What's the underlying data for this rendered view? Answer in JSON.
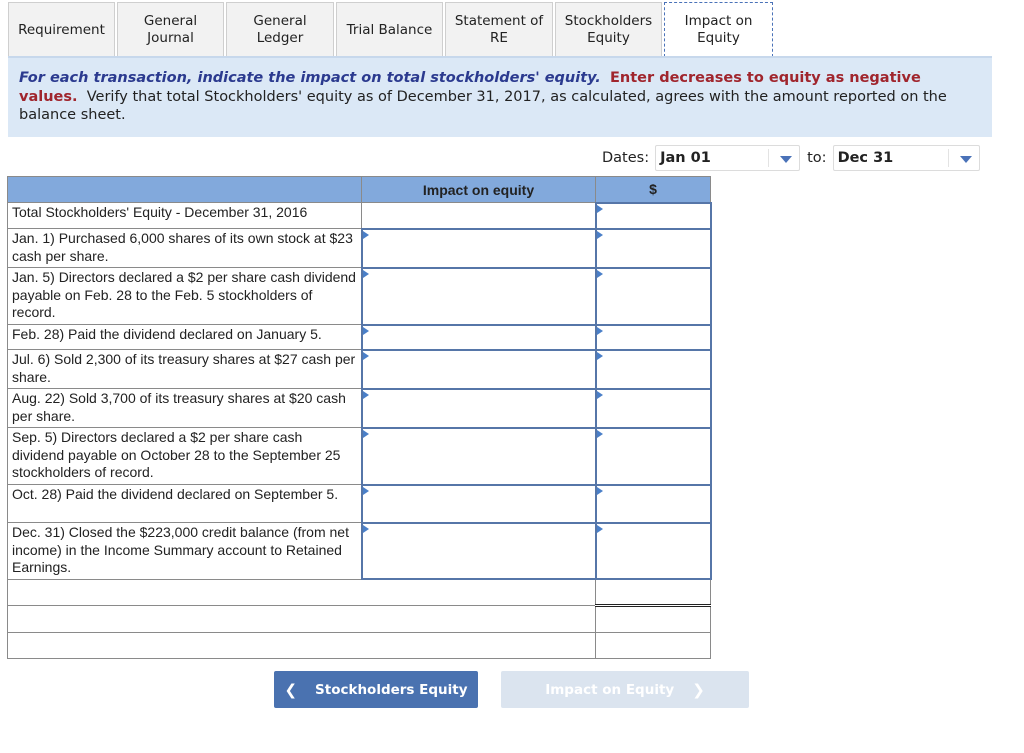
{
  "tabs": [
    {
      "label_l1": "Requirement",
      "label_l2": "",
      "active": false
    },
    {
      "label_l1": "General",
      "label_l2": "Journal",
      "active": false
    },
    {
      "label_l1": "General",
      "label_l2": "Ledger",
      "active": false
    },
    {
      "label_l1": "Trial Balance",
      "label_l2": "",
      "active": false
    },
    {
      "label_l1": "Statement of",
      "label_l2": "RE",
      "active": false
    },
    {
      "label_l1": "Stockholders",
      "label_l2": "Equity",
      "active": false
    },
    {
      "label_l1": "Impact on",
      "label_l2": "Equity",
      "active": true
    }
  ],
  "instructions": {
    "part1": "For each transaction, indicate the impact on total stockholders' equity.",
    "part2": "Enter decreases to equity as negative values.",
    "part3": "Verify that total Stockholders' equity as of December 31, 2017, as calculated, agrees with the amount reported on the balance sheet."
  },
  "dates": {
    "label": "Dates:",
    "from": "Jan 01",
    "to_label": "to:",
    "to": "Dec 31"
  },
  "table": {
    "headers": {
      "description": "",
      "impact": "Impact on equity",
      "amount": "$"
    },
    "rows": [
      {
        "description": "Total Stockholders' Equity - December 31, 2016",
        "impact": "",
        "amount": ""
      },
      {
        "description": "Jan. 1)  Purchased 6,000 shares of its own stock at $23 cash per share.",
        "impact": "",
        "amount": ""
      },
      {
        "description": "Jan. 5)  Directors declared a $2 per share cash dividend payable on Feb. 28 to the Feb. 5 stockholders of record.",
        "impact": "",
        "amount": ""
      },
      {
        "description": "Feb. 28)  Paid the dividend declared on January 5.",
        "impact": "",
        "amount": ""
      },
      {
        "description": "Jul. 6)  Sold 2,300 of its treasury shares at $27 cash per share.",
        "impact": "",
        "amount": ""
      },
      {
        "description": "Aug. 22)  Sold 3,700 of its treasury shares at $20 cash per share.",
        "impact": "",
        "amount": ""
      },
      {
        "description": "Sep. 5)  Directors declared a $2 per share cash dividend payable on October 28 to the September 25 stockholders of record.",
        "impact": "",
        "amount": ""
      },
      {
        "description": "Oct. 28)  Paid the dividend declared on September 5.",
        "impact": "",
        "amount": ""
      },
      {
        "description": "Dec. 31)  Closed the $223,000 credit balance (from net income) in the Income Summary account to Retained Earnings.",
        "impact": "",
        "amount": ""
      }
    ],
    "summary_rows": [
      {
        "description": "",
        "amount": ""
      },
      {
        "description": "",
        "amount": ""
      },
      {
        "description": "",
        "amount": ""
      }
    ]
  },
  "nav": {
    "prev_label": "Stockholders Equity",
    "next_label": "Impact on Equity",
    "prev_icon": "chevron-left-icon",
    "next_icon": "chevron-right-icon"
  },
  "colors": {
    "accent": "#4a72b0",
    "header_bg": "#82a9dc",
    "instr_bg": "#dbe8f6",
    "instr_blue": "#2b3a8f",
    "instr_red": "#a0252d"
  }
}
